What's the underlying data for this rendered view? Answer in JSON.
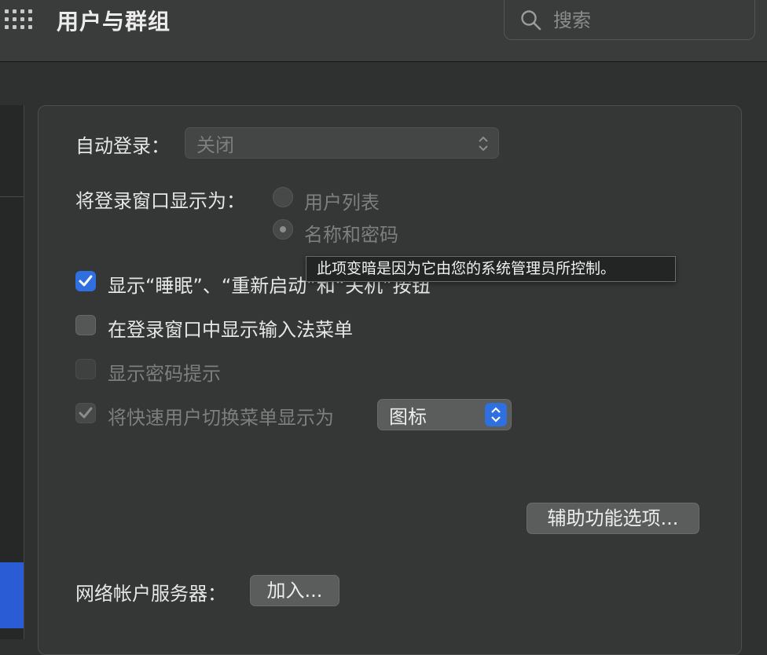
{
  "window": {
    "title": "用户与群组"
  },
  "search": {
    "placeholder": "搜索"
  },
  "login_options": {
    "auto_login": {
      "label": "自动登录：",
      "value": "关闭"
    },
    "display_login_as": {
      "label": "将登录窗口显示为：",
      "options": [
        {
          "label": "用户列表",
          "selected": false
        },
        {
          "label": "名称和密码",
          "selected": true
        }
      ]
    },
    "checkboxes": [
      {
        "label": "显示“睡眠”、“重新启动”和“关机”按钮",
        "checked": true,
        "enabled": true
      },
      {
        "label": "在登录窗口中显示输入法菜单",
        "checked": false,
        "enabled": true
      },
      {
        "label": "显示密码提示",
        "checked": false,
        "enabled": false
      },
      {
        "label": "将快速用户切换菜单显示为",
        "checked": true,
        "enabled": false
      }
    ],
    "fast_user_switch_value": "图标",
    "accessibility_button": "辅助功能选项...",
    "network_server": {
      "label": "网络帐户服务器：",
      "button": "加入..."
    }
  },
  "tooltip": {
    "text": "此项变暗是因为它由您的系统管理员所控制。"
  },
  "colors": {
    "accent": "#2f6fe0",
    "selected_sidebar": "#2a5cd6"
  }
}
